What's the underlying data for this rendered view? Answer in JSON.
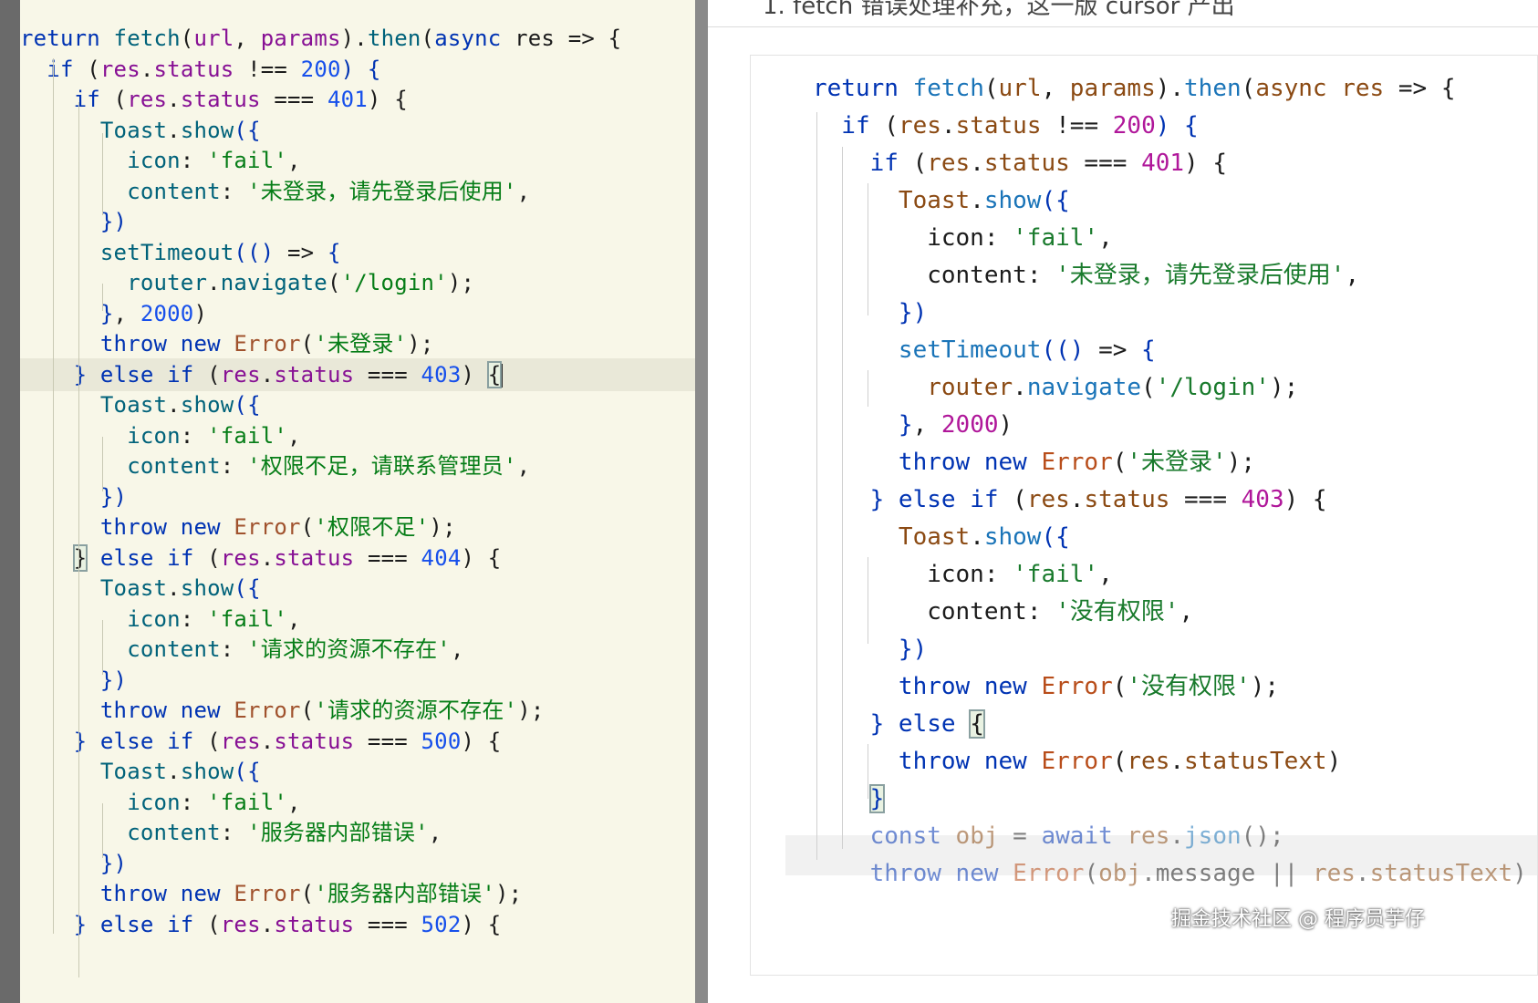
{
  "left_editor": {
    "lines": [
      [
        {
          "t": "return ",
          "c": "kw"
        },
        {
          "t": "fetch",
          "c": "fn"
        },
        {
          "t": "(",
          "c": "pl"
        },
        {
          "t": "url",
          "c": "id"
        },
        {
          "t": ", ",
          "c": "pl"
        },
        {
          "t": "params",
          "c": "id"
        },
        {
          "t": ").",
          "c": "pl"
        },
        {
          "t": "then",
          "c": "fn"
        },
        {
          "t": "(",
          "c": "pl"
        },
        {
          "t": "async ",
          "c": "kw"
        },
        {
          "t": "res => {",
          "c": "pl"
        }
      ],
      [
        {
          "t": "  if ",
          "c": "kw"
        },
        {
          "t": "(",
          "c": "pl"
        },
        {
          "t": "res",
          "c": "id"
        },
        {
          "t": ".",
          "c": "pl"
        },
        {
          "t": "status",
          "c": "id"
        },
        {
          "t": " !== ",
          "c": "pl"
        },
        {
          "t": "200",
          "c": "num"
        },
        {
          "t": ") {",
          "c": "kw"
        }
      ],
      [
        {
          "t": "    if ",
          "c": "kw"
        },
        {
          "t": "(",
          "c": "pl"
        },
        {
          "t": "res",
          "c": "id"
        },
        {
          "t": ".",
          "c": "pl"
        },
        {
          "t": "status",
          "c": "id"
        },
        {
          "t": " === ",
          "c": "pl"
        },
        {
          "t": "401",
          "c": "num"
        },
        {
          "t": ") {",
          "c": "pl"
        }
      ],
      [
        {
          "t": "      Toast",
          "c": "fn"
        },
        {
          "t": ".",
          "c": "pl"
        },
        {
          "t": "show",
          "c": "fn"
        },
        {
          "t": "({",
          "c": "kw"
        }
      ],
      [
        {
          "t": "        icon",
          "c": "fn"
        },
        {
          "t": ": ",
          "c": "pl"
        },
        {
          "t": "'fail'",
          "c": "str"
        },
        {
          "t": ",",
          "c": "pl"
        }
      ],
      [
        {
          "t": "        content",
          "c": "fn"
        },
        {
          "t": ": ",
          "c": "pl"
        },
        {
          "t": "'未登录，请先登录后使用'",
          "c": "str"
        },
        {
          "t": ",",
          "c": "pl"
        }
      ],
      [
        {
          "t": "      })",
          "c": "kw"
        }
      ],
      [
        {
          "t": "      setTimeout",
          "c": "fn"
        },
        {
          "t": "(() ",
          "c": "kw"
        },
        {
          "t": "=> ",
          "c": "pl"
        },
        {
          "t": "{",
          "c": "kw"
        }
      ],
      [
        {
          "t": "        router",
          "c": "fn"
        },
        {
          "t": ".",
          "c": "pl"
        },
        {
          "t": "navigate",
          "c": "fn"
        },
        {
          "t": "(",
          "c": "pl"
        },
        {
          "t": "'/login'",
          "c": "str"
        },
        {
          "t": ");",
          "c": "pl"
        }
      ],
      [
        {
          "t": "      }",
          "c": "kw"
        },
        {
          "t": ", ",
          "c": "pl"
        },
        {
          "t": "2000",
          "c": "num"
        },
        {
          "t": ")",
          "c": "pl"
        }
      ],
      [
        {
          "t": "      throw ",
          "c": "kw"
        },
        {
          "t": "new ",
          "c": "kw"
        },
        {
          "t": "Error",
          "c": "cls"
        },
        {
          "t": "(",
          "c": "pl"
        },
        {
          "t": "'未登录'",
          "c": "str"
        },
        {
          "t": ");",
          "c": "pl"
        }
      ],
      [
        {
          "t": "    } ",
          "c": "kw"
        },
        {
          "t": "else ",
          "c": "kw"
        },
        {
          "t": "if ",
          "c": "kw"
        },
        {
          "t": "(",
          "c": "pl"
        },
        {
          "t": "res",
          "c": "id"
        },
        {
          "t": ".",
          "c": "pl"
        },
        {
          "t": "status",
          "c": "id"
        },
        {
          "t": " === ",
          "c": "pl"
        },
        {
          "t": "403",
          "c": "num"
        },
        {
          "t": ") ",
          "c": "pl"
        },
        {
          "t": "{",
          "c": "pl",
          "box": true
        }
      ],
      [
        {
          "t": "      Toast",
          "c": "fn"
        },
        {
          "t": ".",
          "c": "pl"
        },
        {
          "t": "show",
          "c": "fn"
        },
        {
          "t": "({",
          "c": "kw"
        }
      ],
      [
        {
          "t": "        icon",
          "c": "fn"
        },
        {
          "t": ": ",
          "c": "pl"
        },
        {
          "t": "'fail'",
          "c": "str"
        },
        {
          "t": ",",
          "c": "pl"
        }
      ],
      [
        {
          "t": "        content",
          "c": "fn"
        },
        {
          "t": ": ",
          "c": "pl"
        },
        {
          "t": "'权限不足，请联系管理员'",
          "c": "str"
        },
        {
          "t": ",",
          "c": "pl"
        }
      ],
      [
        {
          "t": "      })",
          "c": "kw"
        }
      ],
      [
        {
          "t": "      throw ",
          "c": "kw"
        },
        {
          "t": "new ",
          "c": "kw"
        },
        {
          "t": "Error",
          "c": "cls"
        },
        {
          "t": "(",
          "c": "pl"
        },
        {
          "t": "'权限不足'",
          "c": "str"
        },
        {
          "t": ");",
          "c": "pl"
        }
      ],
      [
        {
          "t": "    ",
          "c": "pl"
        },
        {
          "t": "}",
          "c": "pl",
          "box": true
        },
        {
          "t": " else ",
          "c": "kw"
        },
        {
          "t": "if ",
          "c": "kw"
        },
        {
          "t": "(",
          "c": "pl"
        },
        {
          "t": "res",
          "c": "id"
        },
        {
          "t": ".",
          "c": "pl"
        },
        {
          "t": "status",
          "c": "id"
        },
        {
          "t": " === ",
          "c": "pl"
        },
        {
          "t": "404",
          "c": "num"
        },
        {
          "t": ") {",
          "c": "pl"
        }
      ],
      [
        {
          "t": "      Toast",
          "c": "fn"
        },
        {
          "t": ".",
          "c": "pl"
        },
        {
          "t": "show",
          "c": "fn"
        },
        {
          "t": "({",
          "c": "kw"
        }
      ],
      [
        {
          "t": "        icon",
          "c": "fn"
        },
        {
          "t": ": ",
          "c": "pl"
        },
        {
          "t": "'fail'",
          "c": "str"
        },
        {
          "t": ",",
          "c": "pl"
        }
      ],
      [
        {
          "t": "        content",
          "c": "fn"
        },
        {
          "t": ": ",
          "c": "pl"
        },
        {
          "t": "'请求的资源不存在'",
          "c": "str"
        },
        {
          "t": ",",
          "c": "pl"
        }
      ],
      [
        {
          "t": "      })",
          "c": "kw"
        }
      ],
      [
        {
          "t": "      throw ",
          "c": "kw"
        },
        {
          "t": "new ",
          "c": "kw"
        },
        {
          "t": "Error",
          "c": "cls"
        },
        {
          "t": "(",
          "c": "pl"
        },
        {
          "t": "'请求的资源不存在'",
          "c": "str"
        },
        {
          "t": ");",
          "c": "pl"
        }
      ],
      [
        {
          "t": "    } ",
          "c": "kw"
        },
        {
          "t": "else ",
          "c": "kw"
        },
        {
          "t": "if ",
          "c": "kw"
        },
        {
          "t": "(",
          "c": "pl"
        },
        {
          "t": "res",
          "c": "id"
        },
        {
          "t": ".",
          "c": "pl"
        },
        {
          "t": "status",
          "c": "id"
        },
        {
          "t": " === ",
          "c": "pl"
        },
        {
          "t": "500",
          "c": "num"
        },
        {
          "t": ") {",
          "c": "pl"
        }
      ],
      [
        {
          "t": "      Toast",
          "c": "fn"
        },
        {
          "t": ".",
          "c": "pl"
        },
        {
          "t": "show",
          "c": "fn"
        },
        {
          "t": "({",
          "c": "kw"
        }
      ],
      [
        {
          "t": "        icon",
          "c": "fn"
        },
        {
          "t": ": ",
          "c": "pl"
        },
        {
          "t": "'fail'",
          "c": "str"
        },
        {
          "t": ",",
          "c": "pl"
        }
      ],
      [
        {
          "t": "        content",
          "c": "fn"
        },
        {
          "t": ": ",
          "c": "pl"
        },
        {
          "t": "'服务器内部错误'",
          "c": "str"
        },
        {
          "t": ",",
          "c": "pl"
        }
      ],
      [
        {
          "t": "      })",
          "c": "kw"
        }
      ],
      [
        {
          "t": "      throw ",
          "c": "kw"
        },
        {
          "t": "new ",
          "c": "kw"
        },
        {
          "t": "Error",
          "c": "cls"
        },
        {
          "t": "(",
          "c": "pl"
        },
        {
          "t": "'服务器内部错误'",
          "c": "str"
        },
        {
          "t": ");",
          "c": "pl"
        }
      ],
      [
        {
          "t": "    } ",
          "c": "kw"
        },
        {
          "t": "else ",
          "c": "kw"
        },
        {
          "t": "if ",
          "c": "kw"
        },
        {
          "t": "(",
          "c": "pl"
        },
        {
          "t": "res",
          "c": "id"
        },
        {
          "t": ".",
          "c": "pl"
        },
        {
          "t": "status",
          "c": "id"
        },
        {
          "t": " === ",
          "c": "pl"
        },
        {
          "t": "502",
          "c": "num"
        },
        {
          "t": ") {",
          "c": "pl"
        }
      ]
    ]
  },
  "right_editor": {
    "header_text": "1. fetch 错误处理补充，这一版 cursor 产出",
    "lines": [
      [
        {
          "t": "return ",
          "c": "rkw"
        },
        {
          "t": "fetch",
          "c": "rfn"
        },
        {
          "t": "(",
          "c": "pl"
        },
        {
          "t": "url",
          "c": "rid"
        },
        {
          "t": ", ",
          "c": "pl"
        },
        {
          "t": "params",
          "c": "rid"
        },
        {
          "t": ").",
          "c": "pl"
        },
        {
          "t": "then",
          "c": "rfn"
        },
        {
          "t": "(",
          "c": "pl"
        },
        {
          "t": "async ",
          "c": "rid"
        },
        {
          "t": "res",
          "c": "rid"
        },
        {
          "t": " => {",
          "c": "pl"
        }
      ],
      [
        {
          "t": "  if ",
          "c": "rkw"
        },
        {
          "t": "(",
          "c": "pl"
        },
        {
          "t": "res",
          "c": "rid"
        },
        {
          "t": ".",
          "c": "pl"
        },
        {
          "t": "status",
          "c": "rid"
        },
        {
          "t": " !== ",
          "c": "pl"
        },
        {
          "t": "200",
          "c": "rnum"
        },
        {
          "t": ") {",
          "c": "rkw"
        }
      ],
      [
        {
          "t": "    if ",
          "c": "rkw"
        },
        {
          "t": "(",
          "c": "pl"
        },
        {
          "t": "res",
          "c": "rid"
        },
        {
          "t": ".",
          "c": "pl"
        },
        {
          "t": "status",
          "c": "rid"
        },
        {
          "t": " === ",
          "c": "pl"
        },
        {
          "t": "401",
          "c": "rnum"
        },
        {
          "t": ") {",
          "c": "pl"
        }
      ],
      [
        {
          "t": "      Toast",
          "c": "rid"
        },
        {
          "t": ".",
          "c": "pl"
        },
        {
          "t": "show",
          "c": "rfn"
        },
        {
          "t": "({",
          "c": "rkw"
        }
      ],
      [
        {
          "t": "        icon",
          "c": "pl"
        },
        {
          "t": ": ",
          "c": "pl"
        },
        {
          "t": "'fail'",
          "c": "rstr"
        },
        {
          "t": ",",
          "c": "pl"
        }
      ],
      [
        {
          "t": "        content",
          "c": "pl"
        },
        {
          "t": ": ",
          "c": "pl"
        },
        {
          "t": "'未登录，请先登录后使用'",
          "c": "rstr"
        },
        {
          "t": ",",
          "c": "pl"
        }
      ],
      [
        {
          "t": "      })",
          "c": "rkw"
        }
      ],
      [
        {
          "t": "      setTimeout",
          "c": "rfn"
        },
        {
          "t": "(() ",
          "c": "rkw"
        },
        {
          "t": "=> ",
          "c": "pl"
        },
        {
          "t": "{",
          "c": "rkw"
        }
      ],
      [
        {
          "t": "        router",
          "c": "rid"
        },
        {
          "t": ".",
          "c": "pl"
        },
        {
          "t": "navigate",
          "c": "rfn"
        },
        {
          "t": "(",
          "c": "pl"
        },
        {
          "t": "'/login'",
          "c": "rstr"
        },
        {
          "t": ");",
          "c": "pl"
        }
      ],
      [
        {
          "t": "      }",
          "c": "rkw"
        },
        {
          "t": ", ",
          "c": "pl"
        },
        {
          "t": "2000",
          "c": "rnum"
        },
        {
          "t": ")",
          "c": "pl"
        }
      ],
      [
        {
          "t": "      throw ",
          "c": "rkw"
        },
        {
          "t": "new ",
          "c": "rkw"
        },
        {
          "t": "Error",
          "c": "rcls"
        },
        {
          "t": "(",
          "c": "pl"
        },
        {
          "t": "'未登录'",
          "c": "rstr"
        },
        {
          "t": ");",
          "c": "pl"
        }
      ],
      [
        {
          "t": "    } ",
          "c": "rkw"
        },
        {
          "t": "else ",
          "c": "rkw"
        },
        {
          "t": "if ",
          "c": "rkw"
        },
        {
          "t": "(",
          "c": "pl"
        },
        {
          "t": "res",
          "c": "rid"
        },
        {
          "t": ".",
          "c": "pl"
        },
        {
          "t": "status",
          "c": "rid"
        },
        {
          "t": " === ",
          "c": "pl"
        },
        {
          "t": "403",
          "c": "rnum"
        },
        {
          "t": ") {",
          "c": "pl"
        }
      ],
      [
        {
          "t": "      Toast",
          "c": "rid"
        },
        {
          "t": ".",
          "c": "pl"
        },
        {
          "t": "show",
          "c": "rfn"
        },
        {
          "t": "({",
          "c": "rkw"
        }
      ],
      [
        {
          "t": "        icon",
          "c": "pl"
        },
        {
          "t": ": ",
          "c": "pl"
        },
        {
          "t": "'fail'",
          "c": "rstr"
        },
        {
          "t": ",",
          "c": "pl"
        }
      ],
      [
        {
          "t": "        content",
          "c": "pl"
        },
        {
          "t": ": ",
          "c": "pl"
        },
        {
          "t": "'没有权限'",
          "c": "rstr"
        },
        {
          "t": ",",
          "c": "pl"
        }
      ],
      [
        {
          "t": "      })",
          "c": "rkw"
        }
      ],
      [
        {
          "t": "      throw ",
          "c": "rkw"
        },
        {
          "t": "new ",
          "c": "rkw"
        },
        {
          "t": "Error",
          "c": "rcls"
        },
        {
          "t": "(",
          "c": "pl"
        },
        {
          "t": "'没有权限'",
          "c": "rstr"
        },
        {
          "t": ");",
          "c": "pl"
        }
      ],
      [
        {
          "t": "    } ",
          "c": "rkw"
        },
        {
          "t": "else ",
          "c": "rkw"
        },
        {
          "t": "{",
          "c": "pl",
          "box": true
        }
      ],
      [
        {
          "t": "      throw ",
          "c": "rkw"
        },
        {
          "t": "new ",
          "c": "rkw"
        },
        {
          "t": "Error",
          "c": "rcls"
        },
        {
          "t": "(",
          "c": "pl"
        },
        {
          "t": "res",
          "c": "rid"
        },
        {
          "t": ".",
          "c": "pl"
        },
        {
          "t": "statusText",
          "c": "rid"
        },
        {
          "t": ")",
          "c": "pl"
        }
      ],
      [
        {
          "t": "    ",
          "c": "pl"
        },
        {
          "t": "}",
          "c": "rkw",
          "box": true
        }
      ],
      [
        {
          "t": "    const ",
          "c": "rkw"
        },
        {
          "t": "obj",
          "c": "rid"
        },
        {
          "t": " = ",
          "c": "pl"
        },
        {
          "t": "await ",
          "c": "rkw"
        },
        {
          "t": "res",
          "c": "rid"
        },
        {
          "t": ".",
          "c": "pl"
        },
        {
          "t": "json",
          "c": "rfn"
        },
        {
          "t": "();",
          "c": "pl"
        }
      ],
      [
        {
          "t": "    throw ",
          "c": "rkw"
        },
        {
          "t": "new ",
          "c": "rkw"
        },
        {
          "t": "Error",
          "c": "rcls"
        },
        {
          "t": "(",
          "c": "pl"
        },
        {
          "t": "obj",
          "c": "rid"
        },
        {
          "t": ".",
          "c": "pl"
        },
        {
          "t": "message",
          "c": "pl"
        },
        {
          "t": " || ",
          "c": "pl"
        },
        {
          "t": "res",
          "c": "rid"
        },
        {
          "t": ".",
          "c": "pl"
        },
        {
          "t": "statusText",
          "c": "rid"
        },
        {
          "t": ")",
          "c": "pl"
        }
      ]
    ]
  },
  "watermark": "掘金技术社区 @ 程序员芋仔"
}
